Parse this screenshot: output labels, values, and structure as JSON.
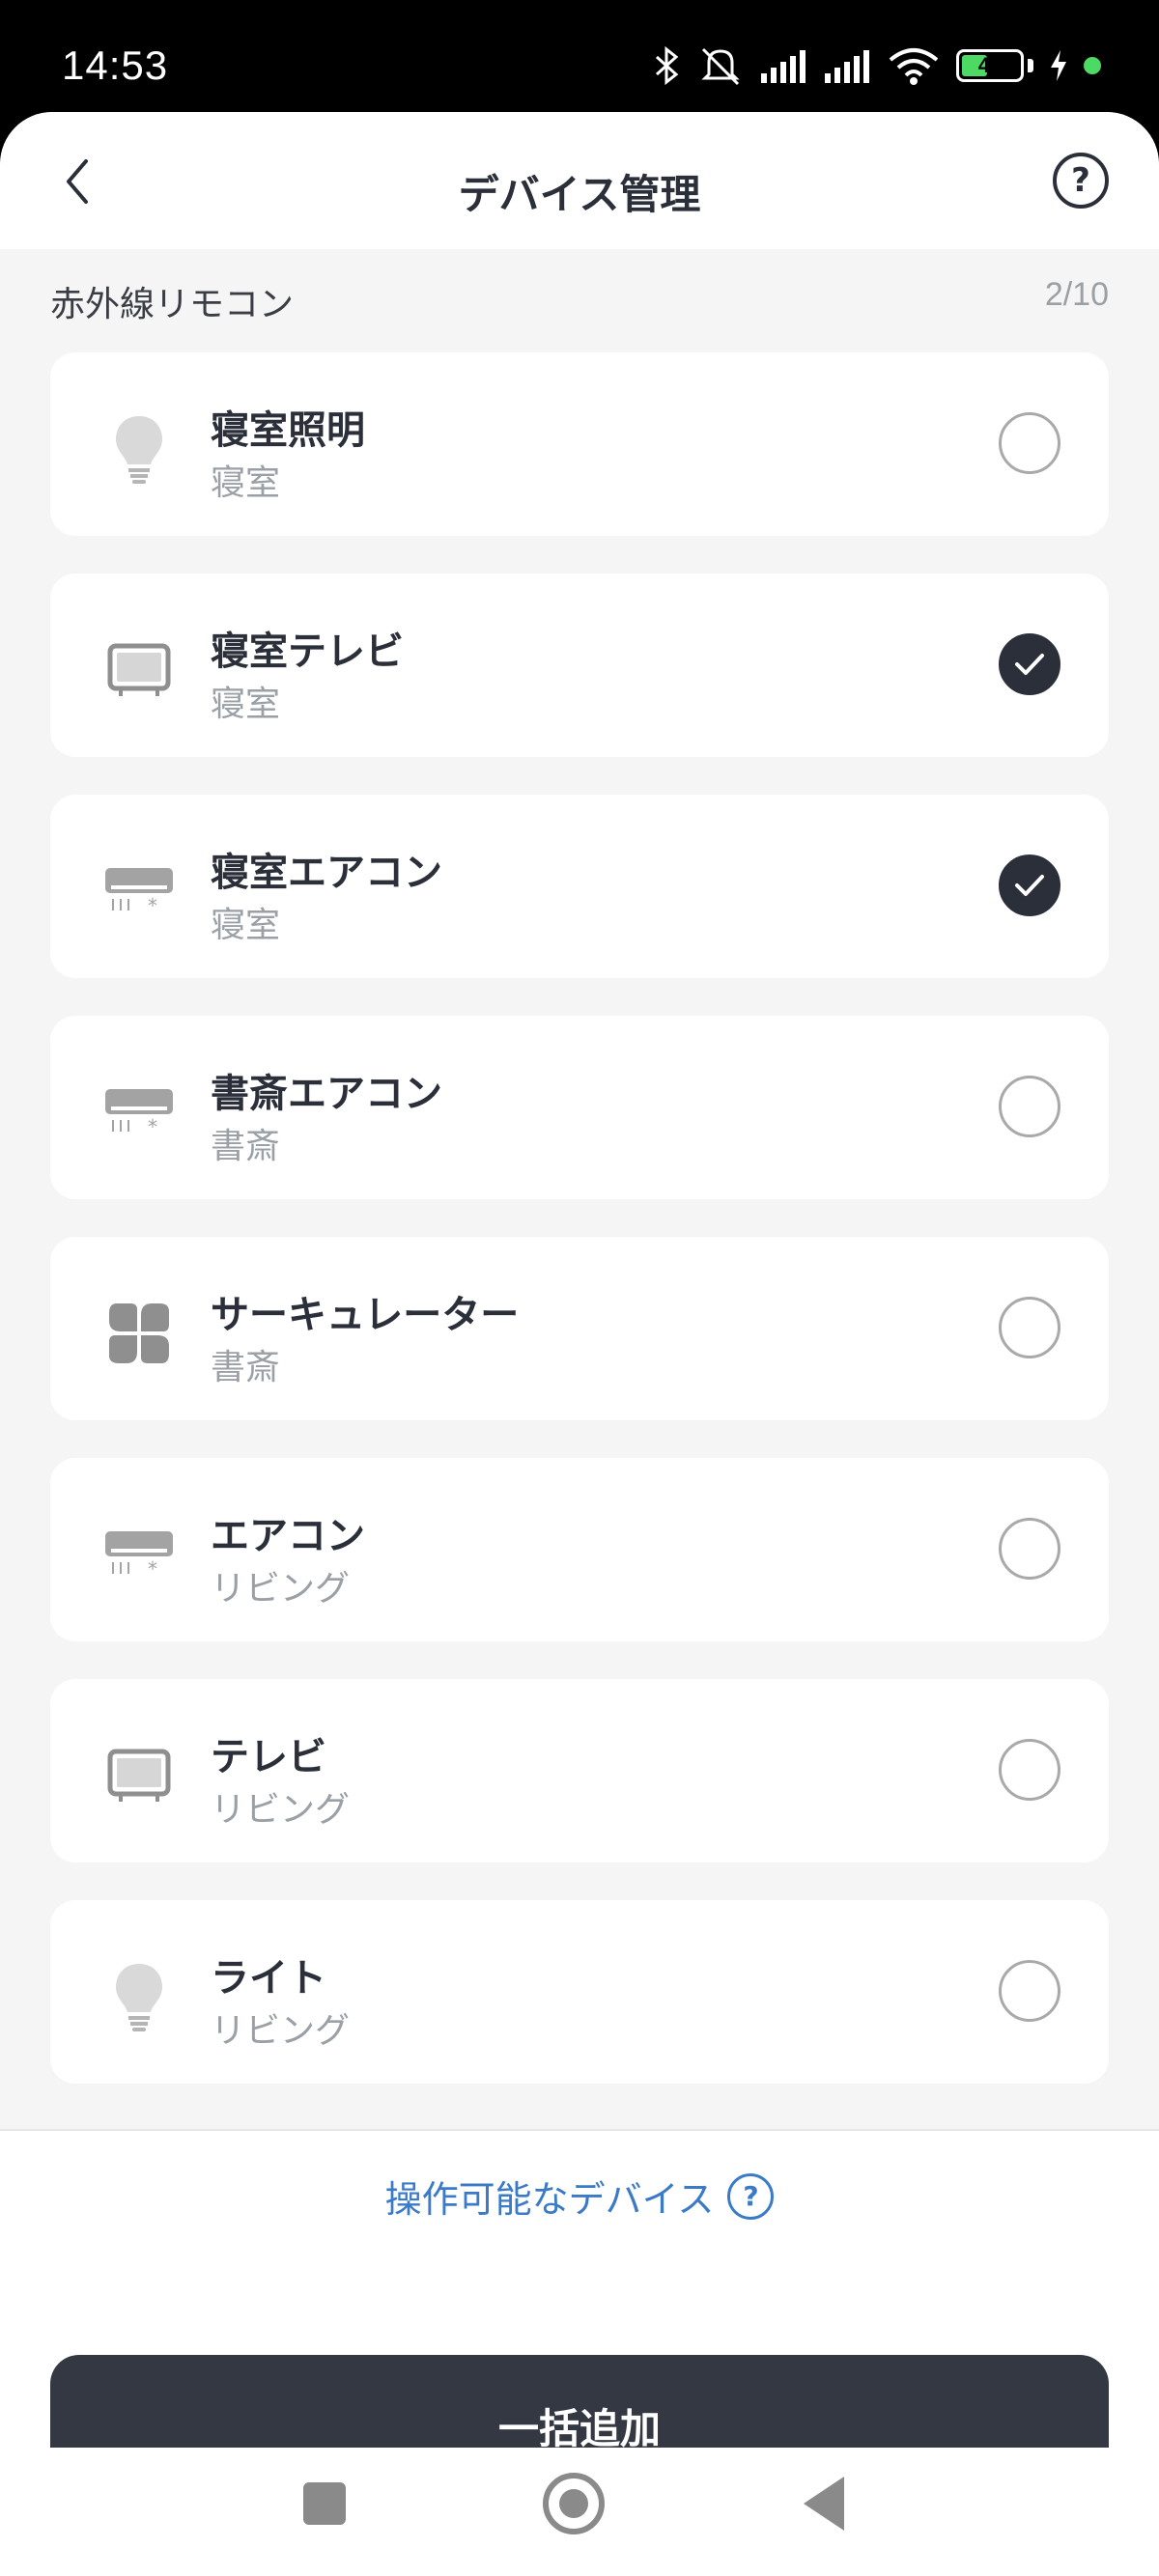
{
  "status_bar": {
    "time": "14:53",
    "battery": "41"
  },
  "header": {
    "title": "デバイス管理",
    "help": "?"
  },
  "section": {
    "label": "赤外線リモコン",
    "count": "2/10"
  },
  "devices": [
    {
      "name": "寝室照明",
      "room": "寝室",
      "icon": "light-bulb-icon",
      "checked": false
    },
    {
      "name": "寝室テレビ",
      "room": "寝室",
      "icon": "tv-icon",
      "checked": true
    },
    {
      "name": "寝室エアコン",
      "room": "寝室",
      "icon": "air-conditioner-icon",
      "checked": true
    },
    {
      "name": "書斎エアコン",
      "room": "書斎",
      "icon": "air-conditioner-icon",
      "checked": false
    },
    {
      "name": "サーキュレーター",
      "room": "書斎",
      "icon": "circulator-fan-icon",
      "checked": false
    },
    {
      "name": "エアコン",
      "room": "リビング",
      "icon": "air-conditioner-icon",
      "checked": false
    },
    {
      "name": "テレビ",
      "room": "リビング",
      "icon": "tv-icon",
      "checked": false
    },
    {
      "name": "ライト",
      "room": "リビング",
      "icon": "light-bulb-icon",
      "checked": false
    }
  ],
  "footer": {
    "operable_devices_link": "操作可能なデバイス",
    "help": "?",
    "bulk_add_button": "一括追加"
  },
  "colors": {
    "primary": "#343843",
    "link": "#3a7ac8",
    "background": "#f5f5f5",
    "battery_green": "#4cd964"
  }
}
